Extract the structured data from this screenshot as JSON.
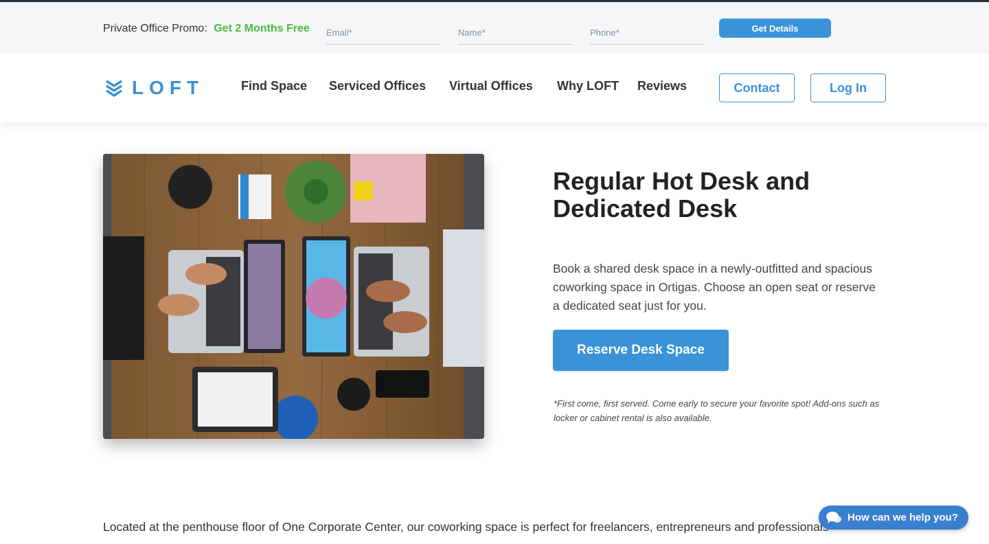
{
  "colors": {
    "accent": "#3a93d6",
    "promo_green": "#4cbb3c",
    "chat": "#3a7fcf"
  },
  "promo": {
    "label": "Private Office Promo:",
    "highlight": "Get 2 Months Free",
    "email_placeholder": "Email*",
    "name_placeholder": "Name*",
    "phone_placeholder": "Phone*",
    "button": "Get Details"
  },
  "nav": {
    "logo": "LOFT",
    "logo_icon": "chevrons-down-icon",
    "links": [
      "Find Space",
      "Serviced Offices",
      "Virtual Offices",
      "Why LOFT",
      "Reviews"
    ],
    "contact": "Contact",
    "login": "Log In"
  },
  "hero": {
    "title": "Regular Hot Desk and Dedicated Desk",
    "description": "Book a shared desk space in a newly-outfitted and spacious coworking space in Ortigas. Choose an open seat or reserve a dedicated seat just for you.",
    "button": "Reserve Desk Space",
    "note": "*First come, first served. Come early to secure your favorite spot! Add-ons such as locker or cabinet rental is also available."
  },
  "body": {
    "intro": "Located at the penthouse floor of One Corporate Center, our coworking space is perfect for freelancers, entrepreneurs and professionals"
  },
  "chat": {
    "label": "How can we help you?",
    "icon": "chat-bubbles-icon"
  }
}
